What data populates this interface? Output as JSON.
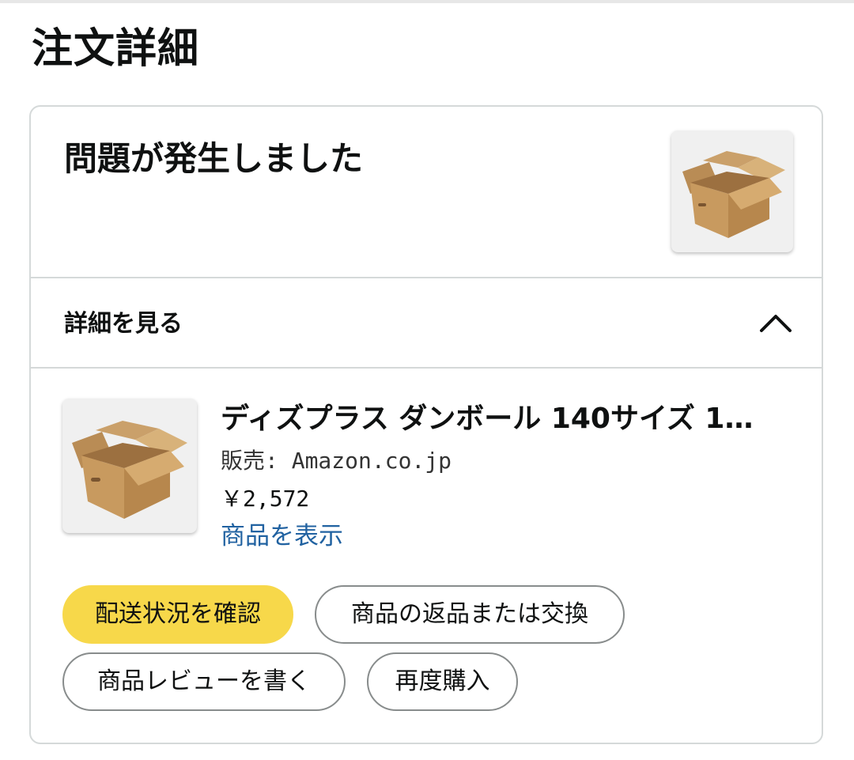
{
  "page": {
    "title": "注文詳細"
  },
  "order_status": {
    "message": "問題が発生しました",
    "thumbnail_icon": "cardboard-box-icon"
  },
  "details_toggle": {
    "label": "詳細を見る",
    "icon": "chevron-up-icon",
    "expanded": true
  },
  "item": {
    "title": "ディズプラス ダンボール 140サイズ 1…",
    "seller": "販売: Amazon.co.jp",
    "price": "￥2,572",
    "view_link": "商品を表示",
    "thumbnail_icon": "cardboard-box-icon"
  },
  "actions": {
    "track_package": "配送状況を確認",
    "return_or_exchange": "商品の返品または交換",
    "write_review": "商品レビューを書く",
    "buy_again": "再度購入"
  },
  "colors": {
    "primary_button": "#f7d84a",
    "link": "#2162a1",
    "border": "#d5d9d9"
  }
}
